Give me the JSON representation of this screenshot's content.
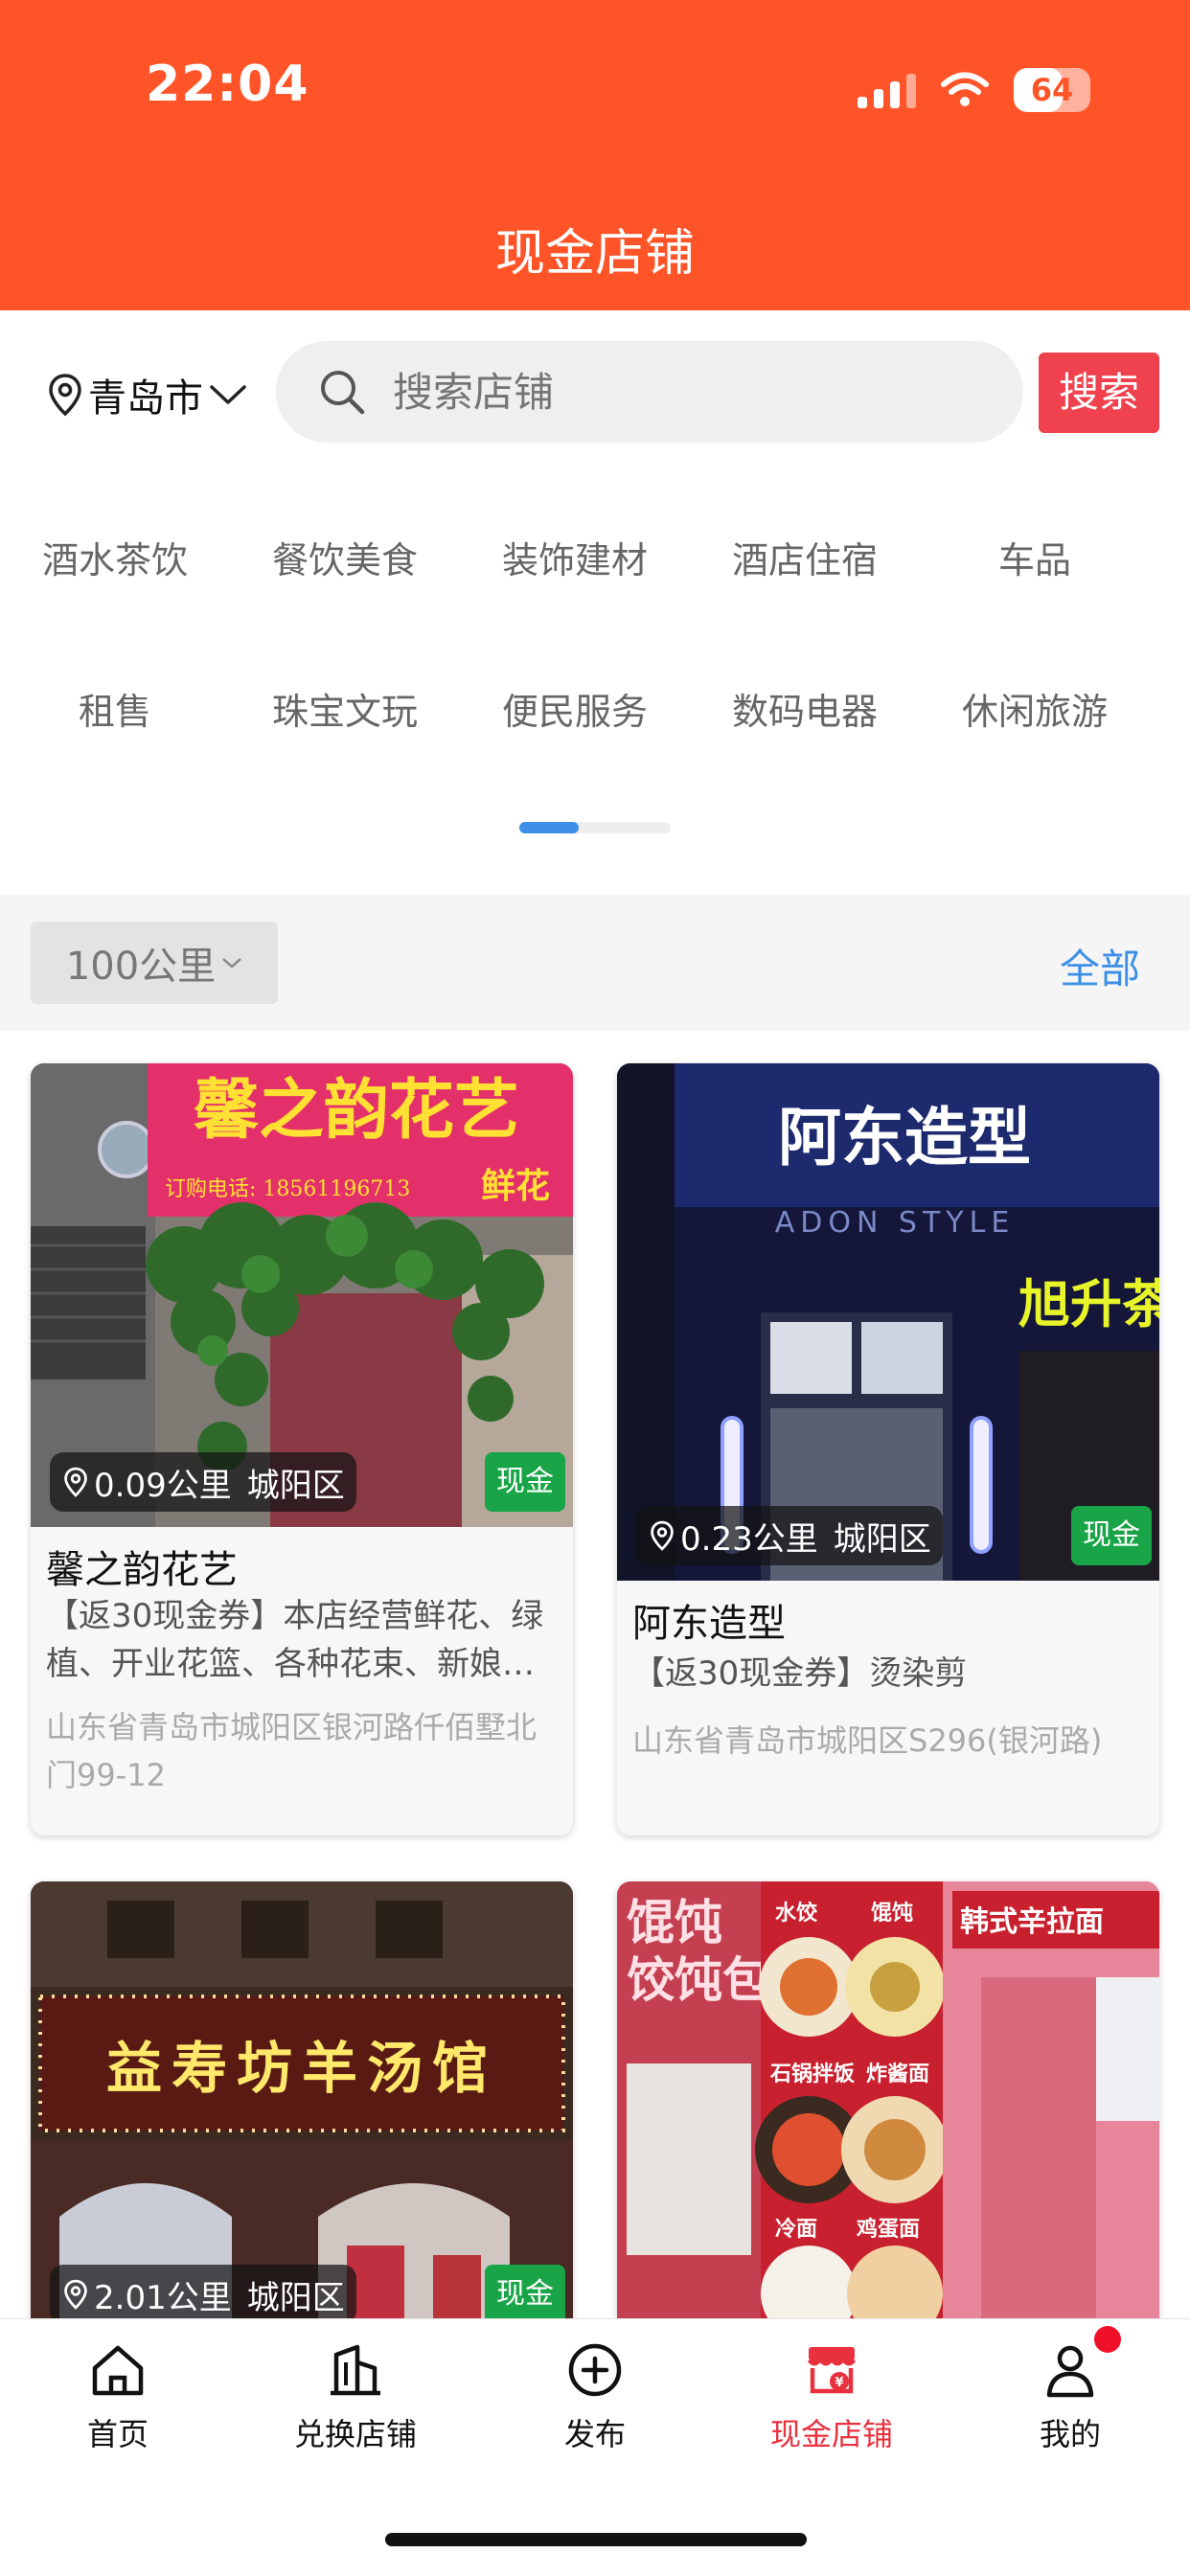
{
  "status_bar": {
    "time": "22:04",
    "battery": "64"
  },
  "header": {
    "title": "现金店铺"
  },
  "search": {
    "city": "青岛市",
    "placeholder": "搜索店铺",
    "button": "搜索"
  },
  "categories": [
    "酒水茶饮",
    "餐饮美食",
    "装饰建材",
    "酒店住宿",
    "车品",
    "租售",
    "珠宝文玩",
    "便民服务",
    "数码电器",
    "休闲旅游"
  ],
  "filter": {
    "distance": "100公里",
    "all": "全部"
  },
  "shops": [
    {
      "distance": "0.09公里",
      "district": "城阳区",
      "badge": "现金",
      "name": "馨之韵花艺",
      "desc": "【返30现金券】本店经营鲜花、绿植、开业花篮、各种花束、新娘…",
      "address": "山东省青岛市城阳区银河路仟佰墅北门99-12",
      "sign_text": "馨之韵花艺",
      "sign_phone": "订购电话: 18561196713",
      "sign_extra": "鲜花"
    },
    {
      "distance": "0.23公里",
      "district": "城阳区",
      "badge": "现金",
      "name": "阿东造型",
      "desc": "【返30现金券】烫染剪",
      "address": "山东省青岛市城阳区S296(银河路)",
      "sign_text": "阿东造型",
      "sign_sub": "ADON STYLE",
      "sign_extra": "旭升茶"
    },
    {
      "distance": "2.01公里",
      "district": "城阳区",
      "badge": "现金",
      "name": "",
      "desc": "",
      "address": "",
      "sign_text": "益寿坊羊汤馆"
    },
    {
      "distance": "",
      "district": "",
      "badge": "",
      "name": "",
      "desc": "",
      "address": "",
      "sign_text": "韩式辛拉面",
      "menu_items": [
        "水饺",
        "馄饨",
        "石锅拌饭",
        "炸酱面",
        "冷面",
        "鸡蛋面"
      ]
    }
  ],
  "tabbar": [
    {
      "label": "首页",
      "icon": "home-icon"
    },
    {
      "label": "兑换店铺",
      "icon": "building-icon"
    },
    {
      "label": "发布",
      "icon": "plus-circle-icon"
    },
    {
      "label": "现金店铺",
      "icon": "cash-shop-icon",
      "active": true
    },
    {
      "label": "我的",
      "icon": "user-icon"
    }
  ],
  "colors": {
    "brand": "#FF5428",
    "accent_blue": "#3E8FE8",
    "search_button": "#F0414E",
    "cash_badge": "#19A447",
    "active_tab": "#E8303E"
  }
}
